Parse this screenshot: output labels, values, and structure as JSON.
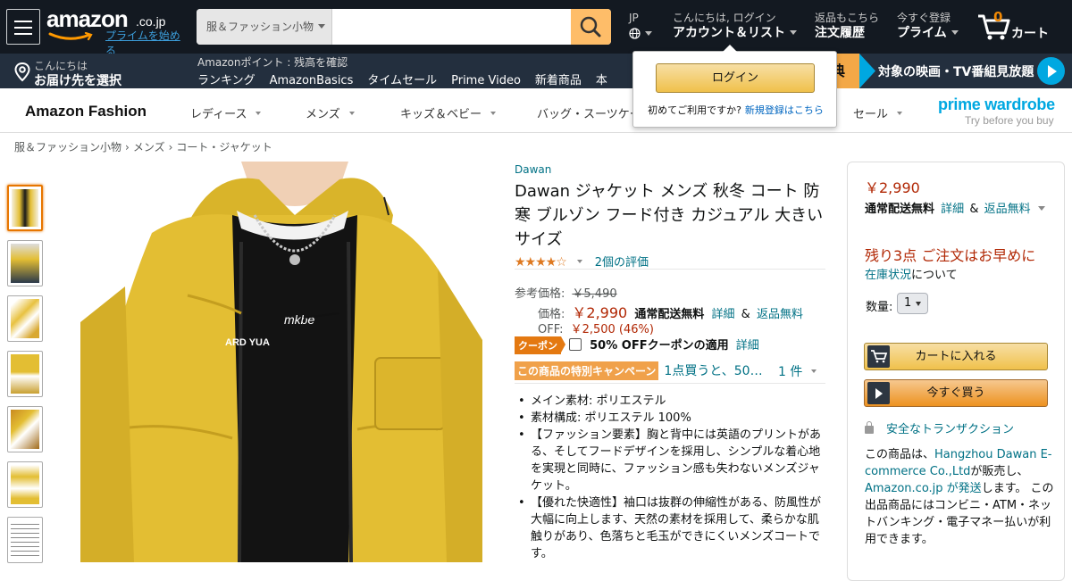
{
  "header": {
    "logo_text": "amazon",
    "logo_tld": ".co.jp",
    "prime_link": "プライムを始める",
    "search_category": "服＆ファッション小物",
    "search_placeholder": "",
    "lang_code": "JP",
    "account_line1": "こんにちは, ログイン",
    "account_line2": "アカウント＆リスト",
    "orders_line1": "返品もこちら",
    "orders_line2": "注文履歴",
    "prime_line1": "今すぐ登録",
    "prime_line2": "プライム",
    "cart_count": "0",
    "cart_label": "カート"
  },
  "subnav": {
    "deliver_line1": "こんにちは",
    "deliver_line2": "お届け先を選択",
    "points": "Amazonポイント : 残高を確認",
    "links": [
      "ランキング",
      "AmazonBasics",
      "タイムセール",
      "Prime Video",
      "新着商品",
      "本"
    ],
    "promo_badge": "典",
    "promo_text": "対象の映画・TV番組見放題"
  },
  "fashion": {
    "title": "Amazon Fashion",
    "categories": [
      "レディース",
      "メンズ",
      "キッズ＆ベビー",
      "バッグ・スーツケー",
      "セール"
    ],
    "prime_wardrobe": "prime wardrobe",
    "prime_wardrobe_sub": "Try before you buy"
  },
  "breadcrumb": [
    "服＆ファッション小物",
    "メンズ",
    "コート・ジャケット"
  ],
  "product": {
    "brand": "Dawan",
    "title": "Dawan ジャケット メンズ 秋冬 コート 防寒 ブルゾン フード付き カジュアル 大きいサイズ",
    "stars": "★★★★☆",
    "rating_count": "2個の評価",
    "list_price_label": "参考価格:",
    "list_price": "￥5,490",
    "price_label": "価格:",
    "price": "￥2,990",
    "shipping_free": "通常配送無料",
    "details_link": "詳細",
    "amp": "&",
    "returns_free": "返品無料",
    "off_label": "OFF:",
    "off_value": "￥2,500 (46%)",
    "coupon_badge": "クーポン",
    "coupon_text": "50% OFFクーポンの適用",
    "coupon_details": "詳細",
    "campaign_badge": "この商品の特別キャンペーン",
    "campaign_text": "1点買うと、50…",
    "campaign_count": "1 件",
    "image_text": "mkbe",
    "image_text2": "ARD YUA",
    "bullets": [
      "メイン素材: ポリエステル",
      "素材構成: ポリエステル 100%",
      "【ファッション要素】胸と背中には英語のプリントがある、そしてフードデザインを採用し、シンプルな着心地を実現と同時に、ファッション感も失わないメンズジャケット。",
      "【優れた快適性】袖口は抜群の伸縮性がある、防風性が大幅に向上します、天然の素材を採用して、柔らかな肌触りがあり、色落ちと毛玉ができにくいメンズコートです。"
    ]
  },
  "buybox": {
    "price": "￥2,990",
    "shipping_free": "通常配送無料",
    "details_link": "詳細",
    "amp": "&",
    "returns_link": "返品無料",
    "stock_text": "残り3点 ご注文はお早めに",
    "stock_link": "在庫状況",
    "stock_suffix": "について",
    "qty_label": "数量:",
    "qty_value": "1",
    "add_to_cart": "カートに入れる",
    "buy_now": "今すぐ買う",
    "secure": "安全なトランザクション",
    "seller_pre": "この商品は、",
    "seller_name": "Hangzhou Dawan E-commerce Co.,Ltd",
    "seller_mid": "が販売し、",
    "ship_by": "Amazon.co.jp が発送",
    "seller_post": "します。 この出品商品にはコンビニ・ATM・ネットバンキング・電子マネー払いが利用できます。"
  },
  "login_popover": {
    "login_button": "ログイン",
    "first_time": "初めてご利用ですか?",
    "register_link": "新規登録はこちら"
  },
  "colors": {
    "nav_dark": "#131921",
    "nav_sub": "#232f3e",
    "accent_orange": "#febd69",
    "price_red": "#b12704",
    "link_teal": "#007185",
    "jacket_yellow": "#e3be33"
  }
}
